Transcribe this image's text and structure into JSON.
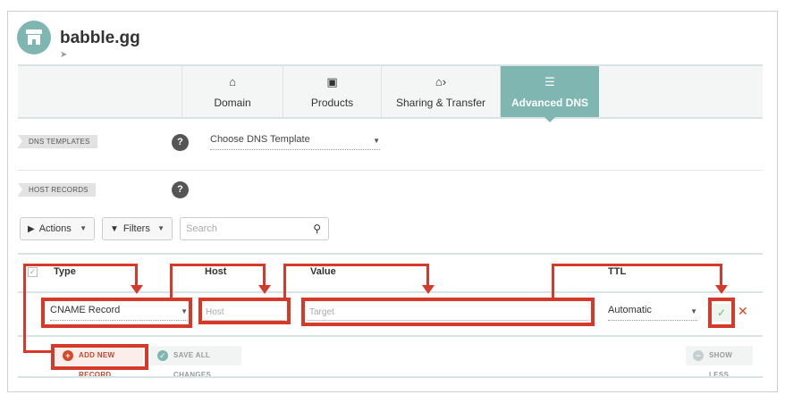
{
  "header": {
    "site_name": "babble.gg",
    "logo_icon": "storefront-icon",
    "sub_icon": "tag-icon"
  },
  "tabs": [
    {
      "label": "Domain",
      "icon": "house-icon",
      "glyph": "⌂",
      "active": false
    },
    {
      "label": "Products",
      "icon": "cube-icon",
      "glyph": "▣",
      "active": false
    },
    {
      "label": "Sharing & Transfer",
      "icon": "share-house-icon",
      "glyph": "⌂›",
      "active": false
    },
    {
      "label": "Advanced DNS",
      "icon": "server-icon",
      "glyph": "☰",
      "active": true
    }
  ],
  "dns_templates": {
    "section_label": "DNS TEMPLATES",
    "help": "?",
    "select_value": "Choose DNS Template"
  },
  "host_records": {
    "section_label": "HOST RECORDS",
    "help": "?"
  },
  "toolbar": {
    "actions_label": "Actions",
    "filters_label": "Filters",
    "search_placeholder": "Search"
  },
  "table": {
    "headers": {
      "type": "Type",
      "host": "Host",
      "value": "Value",
      "ttl": "TTL"
    },
    "new_row": {
      "type": "CNAME Record",
      "host_placeholder": "Host",
      "value_placeholder": "Target",
      "ttl": "Automatic"
    }
  },
  "footer": {
    "add_label": "ADD NEW RECORD",
    "save_label": "SAVE ALL CHANGES",
    "less_label": "SHOW LESS"
  },
  "colors": {
    "accent": "#7fb6b2",
    "annotation": "#d4392a"
  }
}
